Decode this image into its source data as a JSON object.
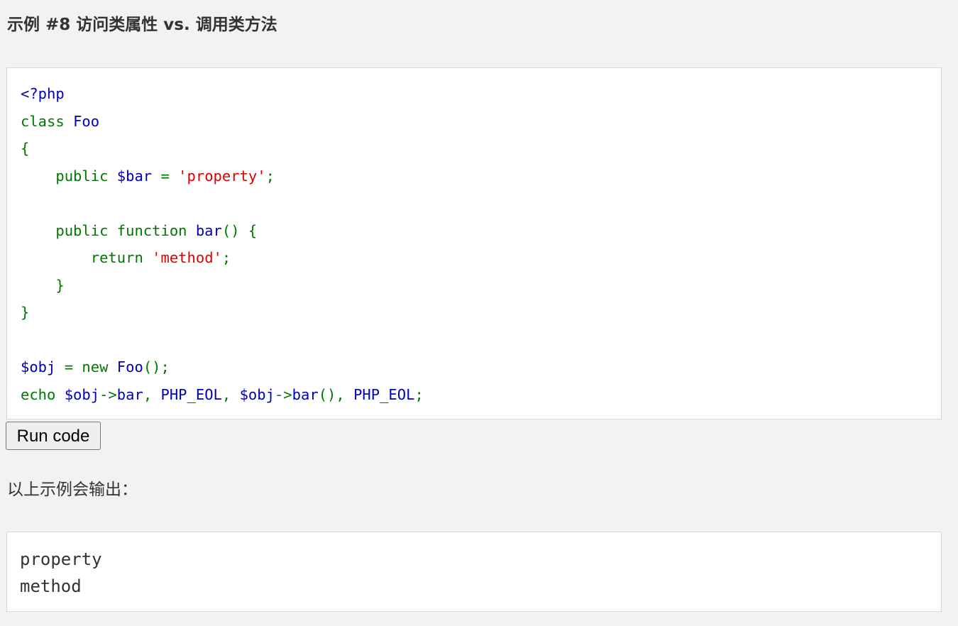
{
  "example": {
    "title": "示例 #8 访问类属性 vs. 调用类方法"
  },
  "code": {
    "language": "php",
    "colors": {
      "default": "#0000bb",
      "keyword": "#007700",
      "string": "#dd0000"
    },
    "lines": [
      [
        {
          "t": "<?php",
          "c": "default"
        }
      ],
      [
        {
          "t": "class ",
          "c": "keyword"
        },
        {
          "t": "Foo",
          "c": "default"
        }
      ],
      [
        {
          "t": "{",
          "c": "keyword"
        }
      ],
      [
        {
          "t": "    public ",
          "c": "keyword"
        },
        {
          "t": "$bar ",
          "c": "default"
        },
        {
          "t": "= ",
          "c": "keyword"
        },
        {
          "t": "'property'",
          "c": "string"
        },
        {
          "t": ";",
          "c": "keyword"
        }
      ],
      [],
      [
        {
          "t": "    public function ",
          "c": "keyword"
        },
        {
          "t": "bar",
          "c": "default"
        },
        {
          "t": "() {",
          "c": "keyword"
        }
      ],
      [
        {
          "t": "        return ",
          "c": "keyword"
        },
        {
          "t": "'method'",
          "c": "string"
        },
        {
          "t": ";",
          "c": "keyword"
        }
      ],
      [
        {
          "t": "    }",
          "c": "keyword"
        }
      ],
      [
        {
          "t": "}",
          "c": "keyword"
        }
      ],
      [],
      [
        {
          "t": "$obj ",
          "c": "default"
        },
        {
          "t": "= new ",
          "c": "keyword"
        },
        {
          "t": "Foo",
          "c": "default"
        },
        {
          "t": "();",
          "c": "keyword"
        }
      ],
      [
        {
          "t": "echo ",
          "c": "keyword"
        },
        {
          "t": "$obj",
          "c": "default"
        },
        {
          "t": "->",
          "c": "keyword"
        },
        {
          "t": "bar",
          "c": "default"
        },
        {
          "t": ", ",
          "c": "keyword"
        },
        {
          "t": "PHP_EOL",
          "c": "default"
        },
        {
          "t": ", ",
          "c": "keyword"
        },
        {
          "t": "$obj",
          "c": "default"
        },
        {
          "t": "->",
          "c": "keyword"
        },
        {
          "t": "bar",
          "c": "default"
        },
        {
          "t": "(), ",
          "c": "keyword"
        },
        {
          "t": "PHP_EOL",
          "c": "default"
        },
        {
          "t": ";",
          "c": "keyword"
        }
      ]
    ]
  },
  "run_button": {
    "label": "Run code"
  },
  "output": {
    "intro": "以上示例会输出：",
    "lines": [
      "property",
      "method"
    ]
  }
}
